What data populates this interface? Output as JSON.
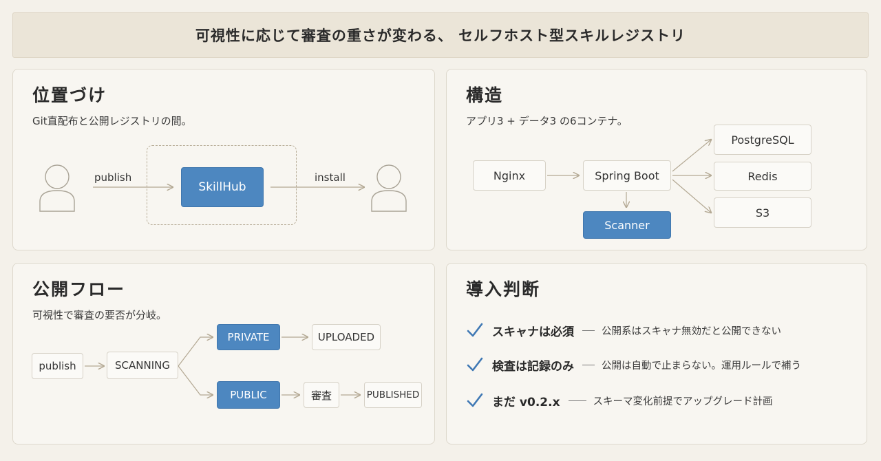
{
  "header": {
    "title": "可視性に応じて審査の重さが変わる、 セルフホスト型スキルレジストリ"
  },
  "positioning": {
    "title": "位置づけ",
    "subtitle": "Git直配布と公開レジストリの間。",
    "center_label": "SkillHub",
    "left_edge_label": "publish",
    "right_edge_label": "install"
  },
  "structure": {
    "title": "構造",
    "subtitle": "アプリ3 + データ3 の6コンテナ。",
    "nodes": {
      "nginx": "Nginx",
      "spring": "Spring Boot",
      "scanner": "Scanner",
      "postgres": "PostgreSQL",
      "redis": "Redis",
      "s3": "S3"
    }
  },
  "flow": {
    "title": "公開フロー",
    "subtitle": "可視性で審査の要否が分岐。",
    "nodes": {
      "publish": "publish",
      "scanning": "SCANNING",
      "private": "PRIVATE",
      "uploaded": "UPLOADED",
      "public": "PUBLIC",
      "review": "審査",
      "published": "PUBLISHED"
    }
  },
  "decision": {
    "title": "導入判断",
    "items": [
      {
        "heading": "スキャナは必須",
        "description": "公開系はスキャナ無効だと公開できない"
      },
      {
        "heading": "検査は記録のみ",
        "description": "公開は自動で止まらない。運用ルールで補う"
      },
      {
        "heading": "まだ v0.2.x",
        "description": "スキーマ変化前提でアップグレード計画"
      }
    ]
  },
  "colors": {
    "accent_blue": "#4d87c0",
    "check_blue": "#3f78b4",
    "arrow": "#b3a893"
  }
}
